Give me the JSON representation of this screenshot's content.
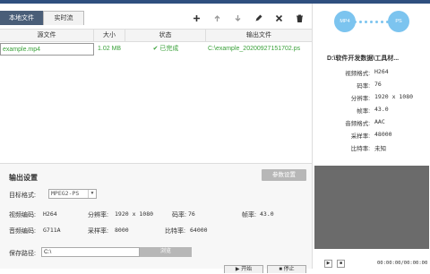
{
  "tabs": [
    {
      "label": "本地文件"
    },
    {
      "label": "实时流"
    }
  ],
  "toolbar": {
    "icons": [
      "plus-icon",
      "arrow-up-icon",
      "arrow-down-icon",
      "edit-icon",
      "delete-icon",
      "trash-icon"
    ]
  },
  "table": {
    "headers": [
      "源文件",
      "大小",
      "状态",
      "输出文件"
    ],
    "rows": [
      {
        "source": "example.mp4",
        "size": "1.02 MB",
        "status": "已完成",
        "output": "C:\\example_20200927151702.ps"
      }
    ]
  },
  "settings": {
    "title": "输出设置",
    "params_button": "参数设置",
    "target_format_label": "目标格式:",
    "target_format_value": "MPEG2-PS",
    "video_codec_label": "视频编码:",
    "video_codec_value": "H264",
    "resolution_label": "分辨率:",
    "resolution_value": "1920 x 1080",
    "video_bitrate_label": "码率:",
    "video_bitrate_value": "76",
    "framerate_label": "帧率:",
    "framerate_value": "43.0",
    "audio_codec_label": "音频编码:",
    "audio_codec_value": "G711A",
    "samplerate_label": "采样率:",
    "samplerate_value": "8000",
    "audio_bitrate_label": "比特率:",
    "audio_bitrate_value": "64000",
    "save_path_label": "保存路径:",
    "save_path_value": "C:\\",
    "browse_button": "浏览",
    "start_button": "开始",
    "stop_button": "停止"
  },
  "preview": {
    "from_format": "MP4",
    "to_format": "PS",
    "path": "D:\\软件开发数据\\工具材...",
    "info": [
      {
        "k": "视频格式:",
        "v": "H264"
      },
      {
        "k": "码率:",
        "v": "76"
      },
      {
        "k": "分辨率:",
        "v": "1920 x 1080"
      },
      {
        "k": "帧率:",
        "v": "43.0"
      },
      {
        "k": "音频格式:",
        "v": "AAC"
      },
      {
        "k": "采样率:",
        "v": "48000"
      },
      {
        "k": "比特率:",
        "v": "未知"
      }
    ],
    "time": "00:00:00/00:00:00"
  }
}
